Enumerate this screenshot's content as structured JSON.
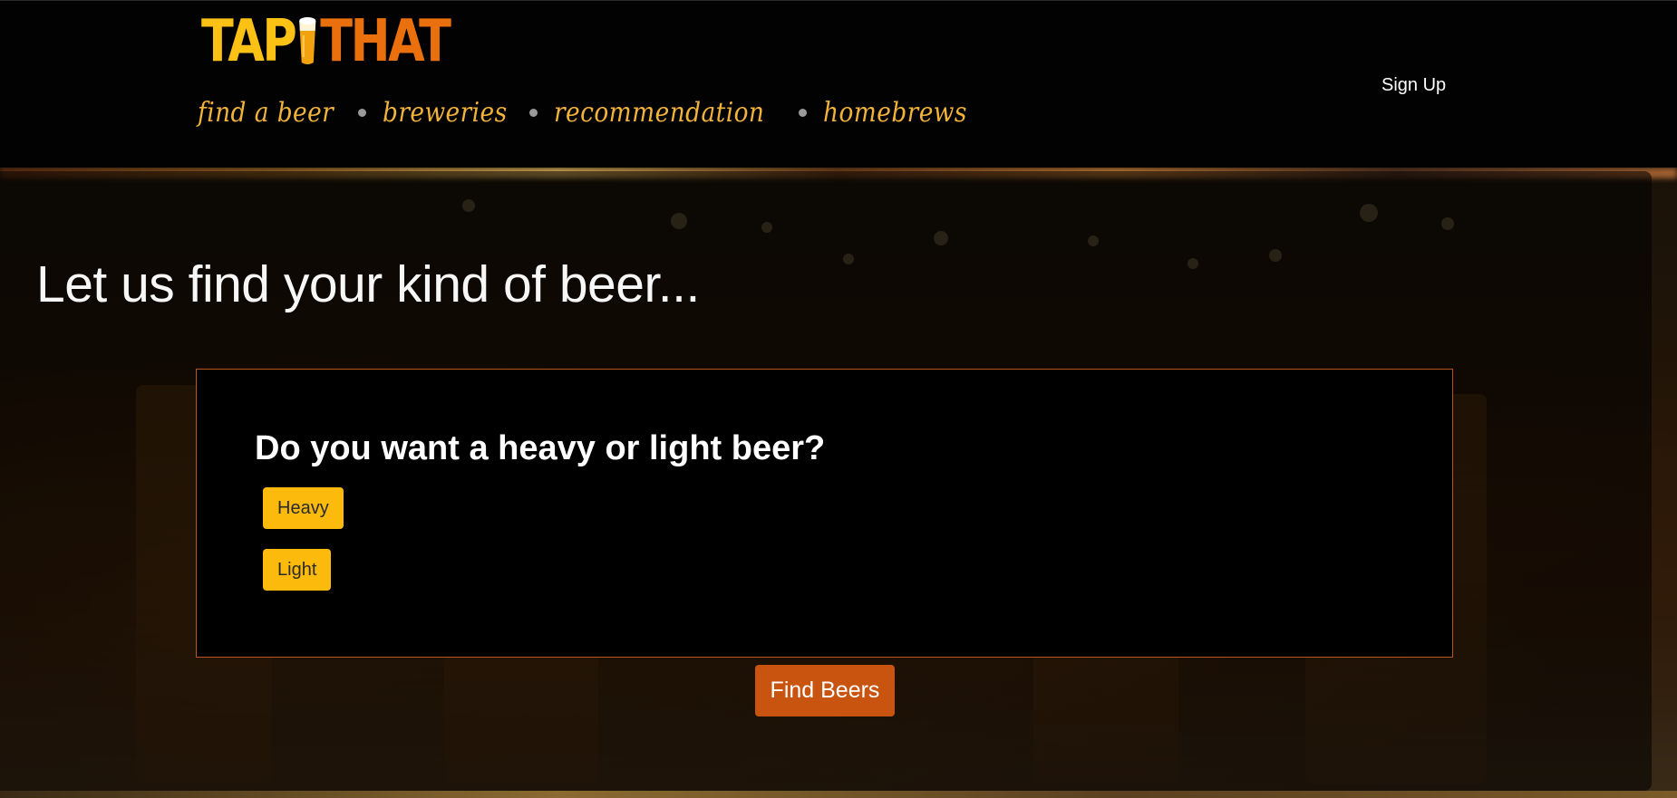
{
  "header": {
    "logo": {
      "left_text": "TAP",
      "right_text": "THAT",
      "glass_icon": "beer-glass-icon"
    },
    "nav": [
      {
        "label": "find a beer"
      },
      {
        "label": "breweries"
      },
      {
        "label": "recommendation"
      },
      {
        "label": "homebrews"
      }
    ],
    "signup_label": "Sign Up"
  },
  "hero": {
    "title": "Let us find your kind of beer..."
  },
  "quiz": {
    "question": "Do you want a heavy or light beer?",
    "options": [
      {
        "label": "Heavy"
      },
      {
        "label": "Light"
      }
    ]
  },
  "actions": {
    "find_label": "Find Beers"
  },
  "colors": {
    "logo_yellow": "#fbc115",
    "logo_orange": "#ea6f0d",
    "nav_text": "#f2b33a",
    "choice_button": "#fbba0c",
    "primary_button": "#c8540f",
    "box_border": "#b9561b"
  }
}
